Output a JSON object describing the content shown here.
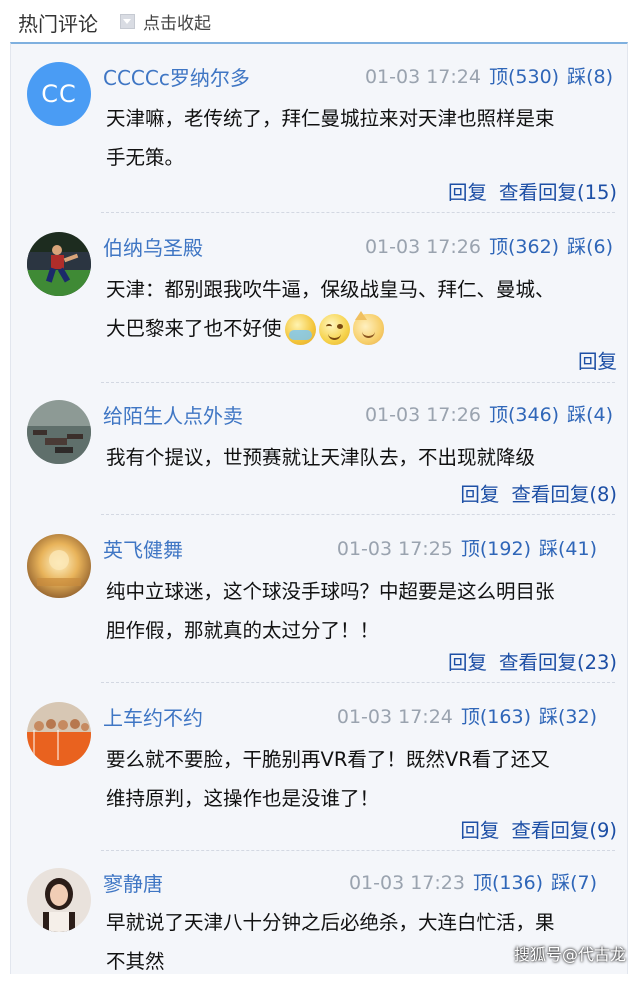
{
  "header": {
    "title": "热门评论",
    "collapse_label": "点击收起"
  },
  "colors": {
    "accent_border": "#7fb0df",
    "username": "#3f76c4",
    "vote": "#2f66b8",
    "action": "#1d4fa5",
    "avatar_cc_bg": "#4a9cf4"
  },
  "comments": [
    {
      "avatar_text": "CC",
      "username": "CCCCc罗纳尔多",
      "time": "01-03 17:24",
      "up": "顶(530)",
      "down": "踩(8)",
      "lines": [
        "天津嘛，老传统了，拜仁曼城拉来对天津也照样是束",
        "手无策。"
      ],
      "reply": "回复",
      "view_replies": "查看回复(15)"
    },
    {
      "username": "伯纳乌圣殿",
      "time": "01-03 17:26",
      "up": "顶(362)",
      "down": "踩(6)",
      "lines": [
        "天津：都别跟我吹牛逼，保级战皇马、拜仁、曼城、",
        "大巴黎来了也不好使"
      ],
      "reply": "回复"
    },
    {
      "username": "给陌生人点外卖",
      "time": "01-03 17:26",
      "up": "顶(346)",
      "down": "踩(4)",
      "lines": [
        "我有个提议，世预赛就让天津队去，不出现就降级"
      ],
      "reply": "回复",
      "view_replies": "查看回复(8)"
    },
    {
      "username": "英飞健舞",
      "time": "01-03 17:25",
      "up": "顶(192)",
      "down": "踩(41)",
      "lines": [
        "纯中立球迷，这个球没手球吗？中超要是这么明目张",
        "胆作假，那就真的太过分了！！"
      ],
      "reply": "回复",
      "view_replies": "查看回复(23)"
    },
    {
      "username": "上车约不约",
      "time": "01-03 17:24",
      "up": "顶(163)",
      "down": "踩(32)",
      "lines": [
        "要么就不要脸，干脆别再VR看了！既然VR看了还又",
        "维持原判，这操作也是没谁了！"
      ],
      "reply": "回复",
      "view_replies": "查看回复(9)"
    },
    {
      "username": "寥静唐",
      "time": "01-03 17:23",
      "up": "顶(136)",
      "down": "踩(7)",
      "lines": [
        "早就说了天津八十分钟之后必绝杀，大连白忙活，果",
        "不其然"
      ]
    }
  ],
  "watermark": "搜狐号@代古龙"
}
